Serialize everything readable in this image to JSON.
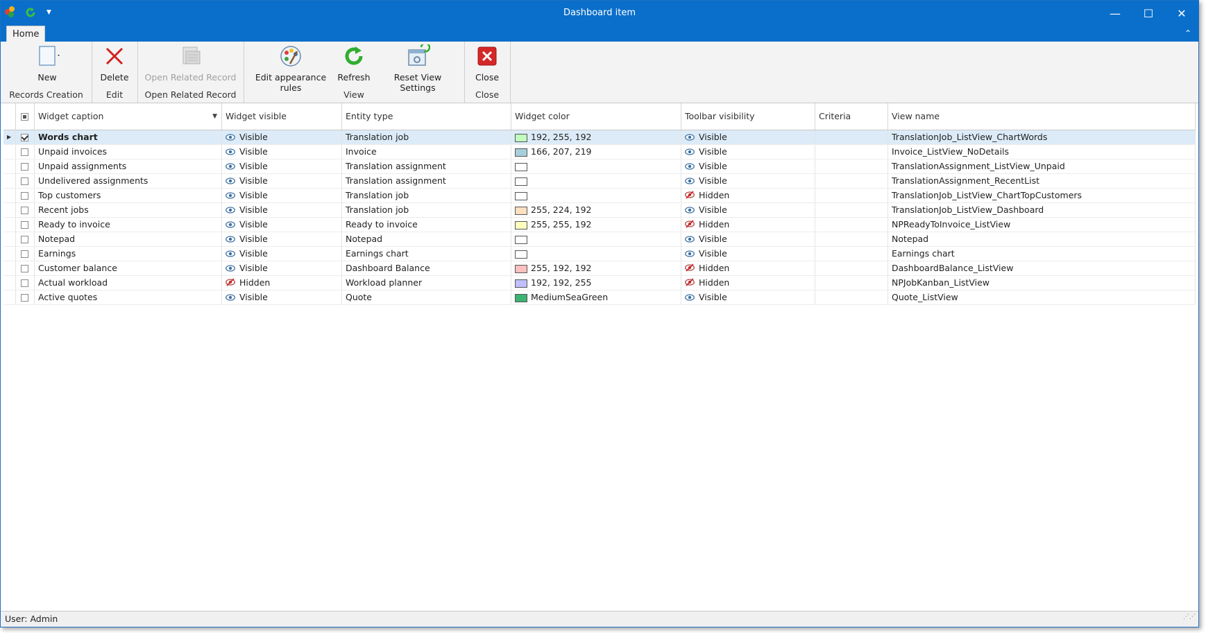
{
  "window": {
    "title": "Dashboard item"
  },
  "ribbon": {
    "tab_home": "Home",
    "groups": {
      "records_creation": "Records Creation",
      "edit": "Edit",
      "open_related": "Open Related Record",
      "view": "View",
      "close": "Close"
    },
    "buttons": {
      "new": "New",
      "delete": "Delete",
      "open_related": "Open Related Record",
      "edit_appearance": "Edit appearance rules",
      "refresh": "Refresh",
      "reset_view": "Reset View Settings",
      "close": "Close"
    }
  },
  "grid": {
    "columns": [
      "Widget caption",
      "Widget visible",
      "Entity type",
      "Widget color",
      "Toolbar visibility",
      "Criteria",
      "View name"
    ],
    "rows": [
      {
        "caption": "Words chart",
        "visible": "Visible",
        "visible_state": "visible",
        "entity": "Translation job",
        "color_text": "192, 255, 192",
        "swatch": "#c0ffc0",
        "toolbar": "Visible",
        "toolbar_state": "visible",
        "criteria": "",
        "view": "TranslationJob_ListView_ChartWords",
        "checked": true,
        "selected": true
      },
      {
        "caption": "Unpaid invoices",
        "visible": "Visible",
        "visible_state": "visible",
        "entity": "Invoice",
        "color_text": "166, 207, 219",
        "swatch": "#a6cfdb",
        "toolbar": "Visible",
        "toolbar_state": "visible",
        "criteria": "",
        "view": "Invoice_ListView_NoDetails",
        "checked": false,
        "selected": false
      },
      {
        "caption": "Unpaid assignments",
        "visible": "Visible",
        "visible_state": "visible",
        "entity": "Translation assignment",
        "color_text": "",
        "swatch": "#ffffff",
        "toolbar": "Visible",
        "toolbar_state": "visible",
        "criteria": "",
        "view": "TranslationAssignment_ListView_Unpaid",
        "checked": false,
        "selected": false
      },
      {
        "caption": "Undelivered assignments",
        "visible": "Visible",
        "visible_state": "visible",
        "entity": "Translation assignment",
        "color_text": "",
        "swatch": "#ffffff",
        "toolbar": "Visible",
        "toolbar_state": "visible",
        "criteria": "",
        "view": "TranslationAssignment_RecentList",
        "checked": false,
        "selected": false
      },
      {
        "caption": "Top customers",
        "visible": "Visible",
        "visible_state": "visible",
        "entity": "Translation job",
        "color_text": "",
        "swatch": "#ffffff",
        "toolbar": "Hidden",
        "toolbar_state": "hidden",
        "criteria": "",
        "view": "TranslationJob_ListView_ChartTopCustomers",
        "checked": false,
        "selected": false
      },
      {
        "caption": "Recent jobs",
        "visible": "Visible",
        "visible_state": "visible",
        "entity": "Translation job",
        "color_text": "255, 224, 192",
        "swatch": "#ffe0c0",
        "toolbar": "Visible",
        "toolbar_state": "visible",
        "criteria": "",
        "view": "TranslationJob_ListView_Dashboard",
        "checked": false,
        "selected": false
      },
      {
        "caption": "Ready to invoice",
        "visible": "Visible",
        "visible_state": "visible",
        "entity": "Ready to invoice",
        "color_text": "255, 255, 192",
        "swatch": "#ffffc0",
        "toolbar": "Hidden",
        "toolbar_state": "hidden",
        "criteria": "",
        "view": "NPReadyToInvoice_ListView",
        "checked": false,
        "selected": false
      },
      {
        "caption": "Notepad",
        "visible": "Visible",
        "visible_state": "visible",
        "entity": "Notepad",
        "color_text": "",
        "swatch": "#ffffff",
        "toolbar": "Visible",
        "toolbar_state": "visible",
        "criteria": "",
        "view": "Notepad",
        "checked": false,
        "selected": false
      },
      {
        "caption": "Earnings",
        "visible": "Visible",
        "visible_state": "visible",
        "entity": "Earnings chart",
        "color_text": "",
        "swatch": "#ffffff",
        "toolbar": "Visible",
        "toolbar_state": "visible",
        "criteria": "",
        "view": "Earnings chart",
        "checked": false,
        "selected": false
      },
      {
        "caption": "Customer balance",
        "visible": "Visible",
        "visible_state": "visible",
        "entity": "Dashboard Balance",
        "color_text": "255, 192, 192",
        "swatch": "#ffc0c0",
        "toolbar": "Hidden",
        "toolbar_state": "hidden",
        "criteria": "",
        "view": "DashboardBalance_ListView",
        "checked": false,
        "selected": false
      },
      {
        "caption": "Actual workload",
        "visible": "Hidden",
        "visible_state": "hidden",
        "entity": "Workload planner",
        "color_text": "192, 192, 255",
        "swatch": "#c0c0ff",
        "toolbar": "Hidden",
        "toolbar_state": "hidden",
        "criteria": "",
        "view": "NPJobKanban_ListView",
        "checked": false,
        "selected": false
      },
      {
        "caption": "Active quotes",
        "visible": "Visible",
        "visible_state": "visible",
        "entity": "Quote",
        "color_text": "MediumSeaGreen",
        "swatch": "#3cb371",
        "toolbar": "Visible",
        "toolbar_state": "visible",
        "criteria": "",
        "view": "Quote_ListView",
        "checked": false,
        "selected": false
      }
    ]
  },
  "status": {
    "user": "User: Admin"
  }
}
